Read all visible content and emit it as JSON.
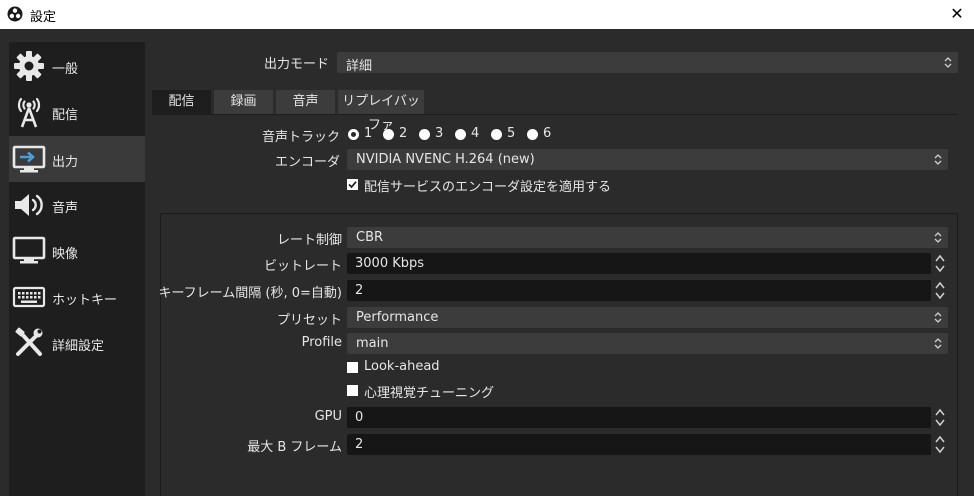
{
  "window": {
    "title": "設定",
    "close_glyph": "✕"
  },
  "sidebar": {
    "items": [
      {
        "label": "一般",
        "icon": "gear-icon"
      },
      {
        "label": "配信",
        "icon": "broadcast-icon"
      },
      {
        "label": "出力",
        "icon": "output-icon"
      },
      {
        "label": "音声",
        "icon": "speaker-icon"
      },
      {
        "label": "映像",
        "icon": "monitor-icon"
      },
      {
        "label": "ホットキー",
        "icon": "keyboard-icon"
      },
      {
        "label": "詳細設定",
        "icon": "tools-icon"
      }
    ],
    "active_index": 2
  },
  "output_mode": {
    "label": "出力モード",
    "value": "詳細"
  },
  "tabs": [
    {
      "label": "配信",
      "active": true
    },
    {
      "label": "録画",
      "active": false
    },
    {
      "label": "音声",
      "active": false
    },
    {
      "label": "リプレイバッファ",
      "active": false
    }
  ],
  "audio_track": {
    "label": "音声トラック",
    "options": [
      "1",
      "2",
      "3",
      "4",
      "5",
      "6"
    ],
    "selected": "1"
  },
  "encoder": {
    "label": "エンコーダ",
    "value": "NVIDIA NVENC H.264 (new)"
  },
  "apply_service_settings": {
    "label": "配信サービスのエンコーダ設定を適用する",
    "checked": true
  },
  "encoder_settings": {
    "rate_control": {
      "label": "レート制御",
      "value": "CBR"
    },
    "bitrate": {
      "label": "ビットレート",
      "value": "3000 Kbps"
    },
    "keyframe_interval": {
      "label": "キーフレーム間隔 (秒, 0=自動)",
      "value": "2"
    },
    "preset": {
      "label": "プリセット",
      "value": "Performance"
    },
    "profile": {
      "label": "Profile",
      "value": "main"
    },
    "look_ahead": {
      "label": "Look-ahead",
      "checked": false
    },
    "psycho_visual_tuning": {
      "label": "心理視覚チューニング",
      "checked": false
    },
    "gpu": {
      "label": "GPU",
      "value": "0"
    },
    "max_b_frames": {
      "label": "最大 B フレーム",
      "value": "2"
    }
  },
  "colors": {
    "background": "#2b2b2b",
    "sidebar": "#1e1e1e",
    "sidebar_active": "#3a3a3a",
    "field": "#3c3c3c",
    "spin_field": "#161616",
    "text": "#e6e6e6"
  }
}
